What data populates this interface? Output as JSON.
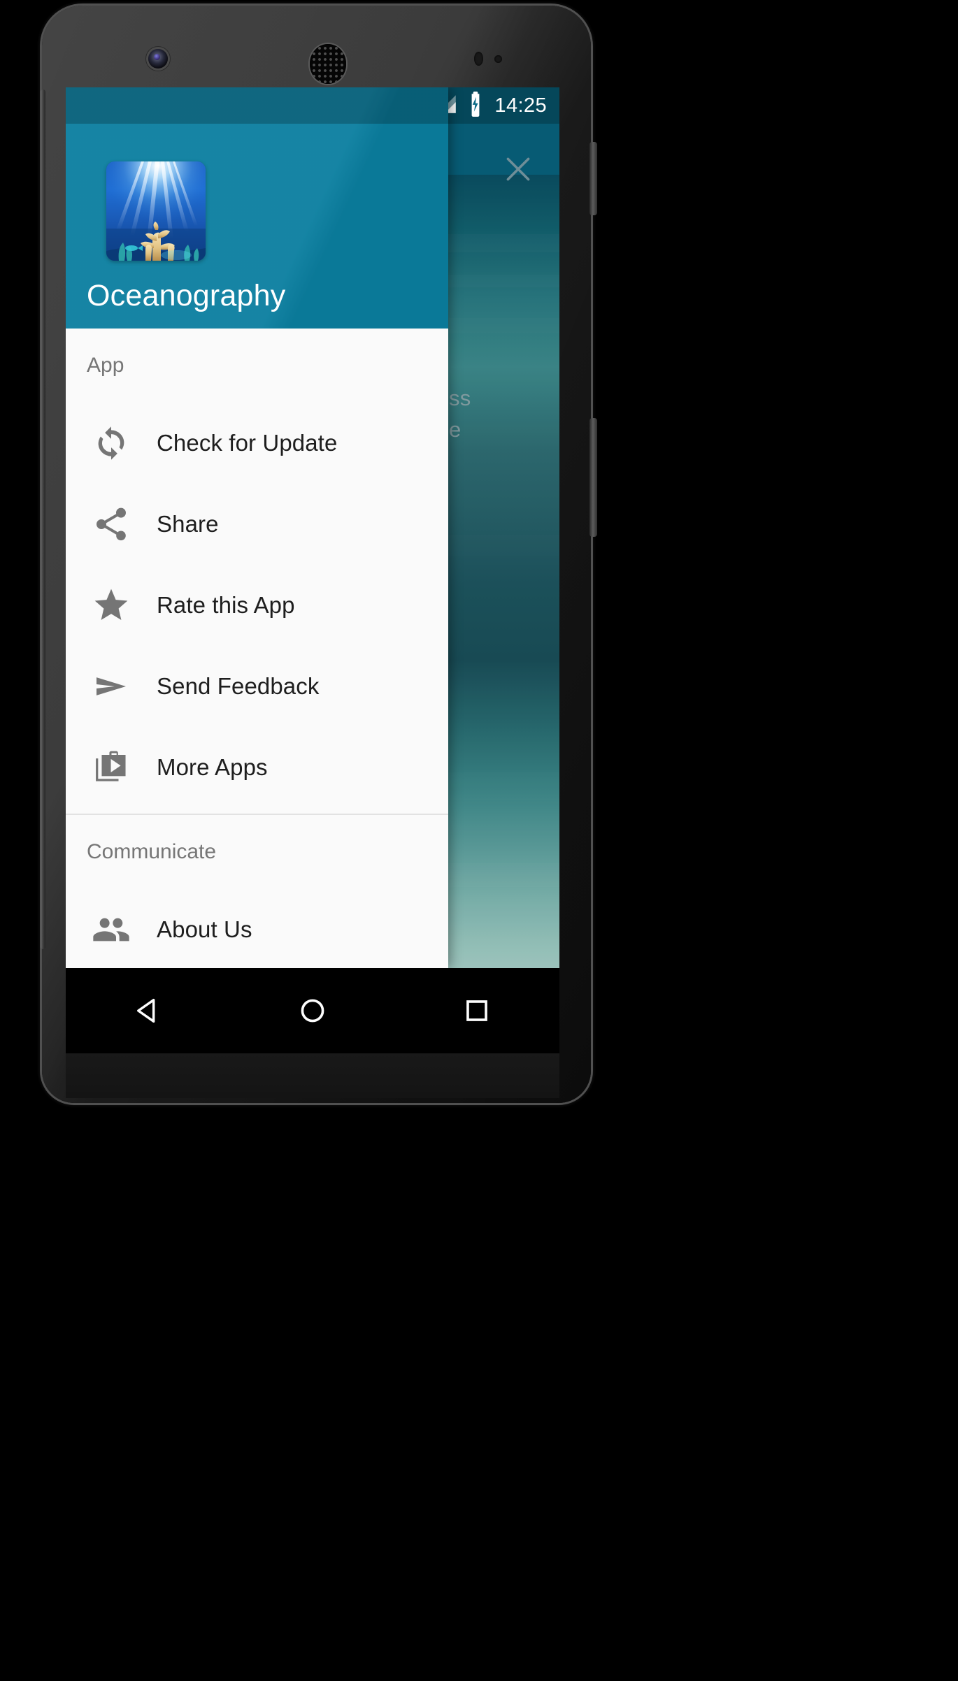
{
  "device": {
    "type": "android-phone-nexus",
    "camera_icon": "front-camera",
    "speaker_icon": "earpiece-speaker"
  },
  "status_bar": {
    "nougat_logo_icon": "android-n-logo",
    "signal_icon": "cellular-signal-icon",
    "battery_icon": "battery-charging-icon",
    "time": "14:25",
    "background_color": "#0a6b86",
    "text_color": "#ffffff"
  },
  "background_activity": {
    "toolbar_color": "#08617c",
    "close_icon": "close-x-icon",
    "visible_text_fragments": [
      "ss",
      "e"
    ]
  },
  "drawer": {
    "header": {
      "background_color": "#0b7fa0",
      "app_icon_name": "oceanography-app-icon",
      "app_icon_description": "underwater coral reef with sun rays",
      "title": "Oceanography",
      "title_color": "#ffffff"
    },
    "sections": [
      {
        "id": "app",
        "header_label": "App",
        "header_color": "#767676",
        "items": [
          {
            "icon": "refresh-sync-icon",
            "label": "Check for Update"
          },
          {
            "icon": "share-icon",
            "label": "Share"
          },
          {
            "icon": "star-icon",
            "label": "Rate this App"
          },
          {
            "icon": "send-icon",
            "label": "Send Feedback"
          },
          {
            "icon": "shop-play-icon",
            "label": "More Apps"
          }
        ]
      },
      {
        "id": "communicate",
        "header_label": "Communicate",
        "header_color": "#767676",
        "items": [
          {
            "icon": "people-icon",
            "label": "About Us"
          }
        ]
      }
    ],
    "item_icon_color": "#757575",
    "item_text_color": "#1e1e1e",
    "background_color": "#fafafa"
  },
  "nav_bar": {
    "background_color": "#000000",
    "keys": [
      {
        "icon": "back-triangle-icon",
        "name": "back"
      },
      {
        "icon": "home-circle-icon",
        "name": "home"
      },
      {
        "icon": "recents-square-icon",
        "name": "recents"
      }
    ]
  }
}
